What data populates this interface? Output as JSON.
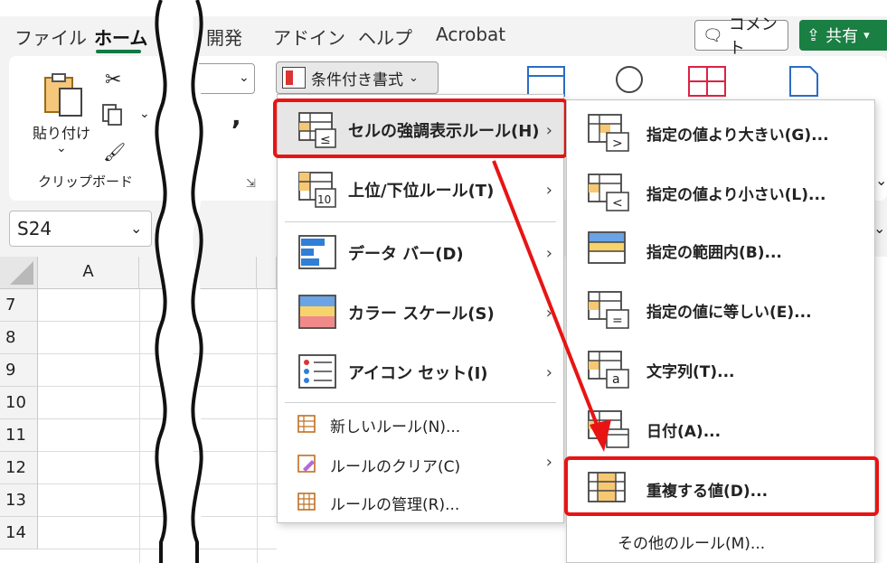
{
  "tabs": [
    "ファイル",
    "ホーム",
    "開発",
    "アドイン",
    "ヘルプ",
    "Acrobat"
  ],
  "active_tab": "ホーム",
  "header_buttons": {
    "comment": "コメント",
    "share": "共有"
  },
  "clipboard": {
    "paste_label": "貼り付け",
    "group_label": "クリップボード"
  },
  "conditional_format_button": "条件付き書式",
  "namebox": "S24",
  "column_headers": [
    "A"
  ],
  "row_headers": [
    "7",
    "8",
    "9",
    "10",
    "11",
    "12",
    "13",
    "14"
  ],
  "menu1": {
    "items": [
      {
        "label": "セルの強調表示ルール(H)",
        "has_submenu": true,
        "highlighted": true
      },
      {
        "label": "上位/下位ルール(T)",
        "has_submenu": true
      },
      {
        "label": "データ バー(D)",
        "has_submenu": true
      },
      {
        "label": "カラー スケール(S)",
        "has_submenu": true
      },
      {
        "label": "アイコン セット(I)",
        "has_submenu": true
      }
    ],
    "small_items": [
      {
        "label": "新しいルール(N)..."
      },
      {
        "label": "ルールのクリア(C)",
        "has_submenu": true
      },
      {
        "label": "ルールの管理(R)..."
      }
    ]
  },
  "menu2": {
    "items": [
      {
        "label": "指定の値より大きい(G)..."
      },
      {
        "label": "指定の値より小さい(L)..."
      },
      {
        "label": "指定の範囲内(B)..."
      },
      {
        "label": "指定の値に等しい(E)..."
      },
      {
        "label": "文字列(T)..."
      },
      {
        "label": "日付(A)..."
      },
      {
        "label": "重複する値(D)...",
        "highlighted": true
      }
    ],
    "more": "その他のルール(M)..."
  },
  "colors": {
    "highlight": "#e81414",
    "accent": "#117a45",
    "share": "#1a7f43"
  }
}
